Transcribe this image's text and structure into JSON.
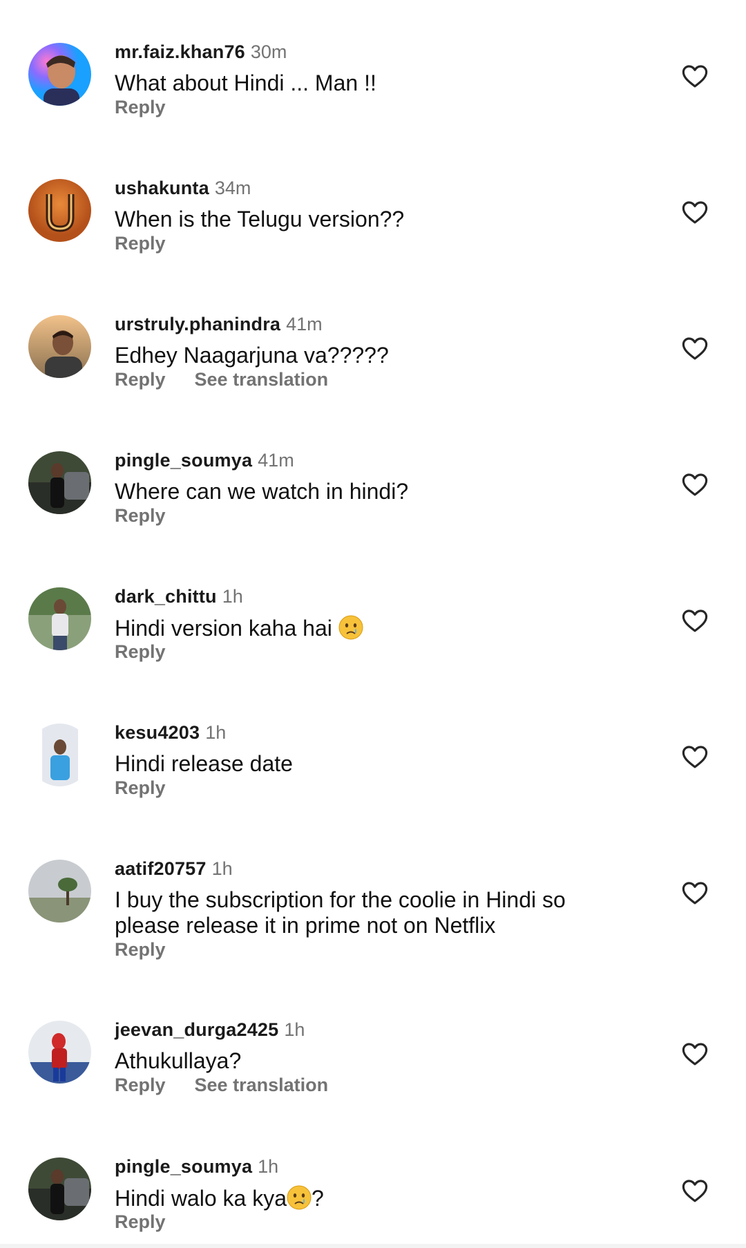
{
  "ui": {
    "reply_label": "Reply",
    "translation_label": "See translation"
  },
  "colors": {
    "meta_gray": "#737373",
    "text": "#111111"
  },
  "comments": [
    {
      "username": "mr.faiz.khan76",
      "time": "30m",
      "text": "What about Hindi ... Man !!",
      "avatar_icon": "avatar-photo"
    },
    {
      "username": "ushakunta",
      "time": "34m",
      "text": "When is the Telugu version??",
      "avatar_icon": "letter-u-avatar"
    },
    {
      "username": "urstruly.phanindra",
      "time": "41m",
      "text": "Edhey Naagarjuna va?????",
      "avatar_icon": "avatar-photo"
    },
    {
      "username": "pingle_soumya",
      "time": "41m",
      "text": "Where can we watch in hindi?",
      "avatar_icon": "avatar-photo"
    },
    {
      "username": "dark_chittu",
      "time": "1h",
      "text": "Hindi version kaha hai ",
      "avatar_icon": "avatar-photo"
    },
    {
      "username": "kesu4203",
      "time": "1h",
      "text": "Hindi release date",
      "avatar_icon": "avatar-photo"
    },
    {
      "username": "aatif20757",
      "time": "1h",
      "text": "I buy the subscription for the coolie in Hindi so please release it in prime not on Netflix",
      "avatar_icon": "avatar-photo"
    },
    {
      "username": "jeevan_durga2425",
      "time": "1h",
      "text": "Athukullaya?",
      "avatar_icon": "avatar-photo"
    },
    {
      "username": "pingle_soumya",
      "time": "1h",
      "text_before": "Hindi walo ka kya",
      "text_after": "?",
      "avatar_icon": "avatar-photo"
    }
  ]
}
